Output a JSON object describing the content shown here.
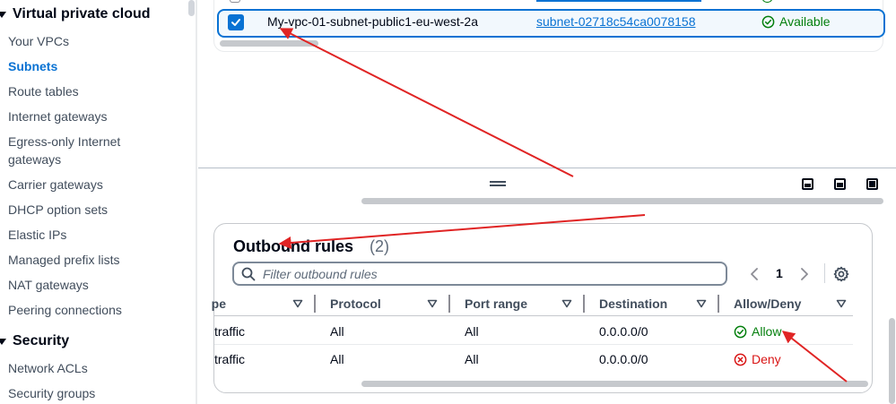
{
  "sidebar": {
    "sections": [
      {
        "heading": "Virtual private cloud",
        "items": [
          {
            "label": "Your VPCs"
          },
          {
            "label": "Subnets"
          },
          {
            "label": "Route tables"
          },
          {
            "label": "Internet gateways"
          },
          {
            "label": "Egress-only Internet gateways"
          },
          {
            "label": "Carrier gateways"
          },
          {
            "label": "DHCP option sets"
          },
          {
            "label": "Elastic IPs"
          },
          {
            "label": "Managed prefix lists"
          },
          {
            "label": "NAT gateways"
          },
          {
            "label": "Peering connections"
          }
        ]
      },
      {
        "heading": "Security",
        "items": [
          {
            "label": "Network ACLs"
          },
          {
            "label": "Security groups"
          }
        ]
      }
    ],
    "active_item": "Subnets"
  },
  "subnets_table": {
    "selected_row": {
      "checked": true,
      "name": "My-vpc-01-subnet-public1-eu-west-2a",
      "subnet_id": "subnet-02718c54ca0078158",
      "state": "Available"
    }
  },
  "outbound_rules": {
    "title": "Outbound rules",
    "count": "(2)",
    "filter_placeholder": "Filter outbound rules",
    "pagination": {
      "current_page": "1"
    },
    "columns": [
      {
        "label": "pe"
      },
      {
        "label": "Protocol"
      },
      {
        "label": "Port range"
      },
      {
        "label": "Destination"
      },
      {
        "label": "Allow/Deny"
      }
    ],
    "rows": [
      {
        "type": "traffic",
        "protocol": "All",
        "port_range": "All",
        "destination": "0.0.0.0/0",
        "allow_deny": "Allow"
      },
      {
        "type": "traffic",
        "protocol": "All",
        "port_range": "All",
        "destination": "0.0.0.0/0",
        "allow_deny": "Deny"
      }
    ]
  },
  "colors": {
    "accent": "#0972d3",
    "success": "#037f0c",
    "error": "#d91515",
    "annotation": "#e02424"
  },
  "icons": {
    "selected_checkbox": "check-icon",
    "available_status": "status-success-icon",
    "filter": "search-icon",
    "prev_page": "chevron-left-icon",
    "next_page": "chevron-right-icon",
    "preferences": "gear-icon",
    "sort": "caret-down-icon",
    "allow": "status-success-icon",
    "deny": "status-error-icon"
  }
}
